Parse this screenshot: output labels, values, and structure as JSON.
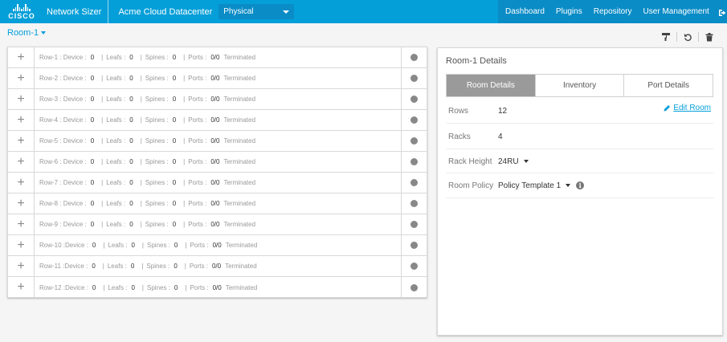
{
  "header": {
    "logo_text": "CISCO",
    "app_title": "Network Sizer",
    "datacenter": "Acme Cloud Datacenter",
    "view_select": "Physical",
    "nav": [
      "Dashboard",
      "Plugins",
      "Repository",
      "User Management"
    ],
    "accent_color": "#049fd9"
  },
  "room_selector": {
    "label": "Room-1"
  },
  "toolbar": {
    "icons": [
      "paint-roller-icon",
      "undo-icon",
      "trash-icon"
    ]
  },
  "labels": {
    "device": "Device :",
    "leafs": "Leafs :",
    "spines": "Spines :",
    "ports": "Ports :",
    "terminated": "Terminated",
    "sep": "|"
  },
  "rows": [
    {
      "name": "Row-1 :",
      "device": "0",
      "leafs": "0",
      "spines": "0",
      "ports": "0/0"
    },
    {
      "name": "Row-2 :",
      "device": "0",
      "leafs": "0",
      "spines": "0",
      "ports": "0/0"
    },
    {
      "name": "Row-3 :",
      "device": "0",
      "leafs": "0",
      "spines": "0",
      "ports": "0/0"
    },
    {
      "name": "Row-4 :",
      "device": "0",
      "leafs": "0",
      "spines": "0",
      "ports": "0/0"
    },
    {
      "name": "Row-5 :",
      "device": "0",
      "leafs": "0",
      "spines": "0",
      "ports": "0/0"
    },
    {
      "name": "Row-6 :",
      "device": "0",
      "leafs": "0",
      "spines": "0",
      "ports": "0/0"
    },
    {
      "name": "Row-7 :",
      "device": "0",
      "leafs": "0",
      "spines": "0",
      "ports": "0/0"
    },
    {
      "name": "Row-8 :",
      "device": "0",
      "leafs": "0",
      "spines": "0",
      "ports": "0/0"
    },
    {
      "name": "Row-9 :",
      "device": "0",
      "leafs": "0",
      "spines": "0",
      "ports": "0/0"
    },
    {
      "name": "Row-10 :",
      "device": "0",
      "leafs": "0",
      "spines": "0",
      "ports": "0/0"
    },
    {
      "name": "Row-11 :",
      "device": "0",
      "leafs": "0",
      "spines": "0",
      "ports": "0/0"
    },
    {
      "name": "Row-12 :",
      "device": "0",
      "leafs": "0",
      "spines": "0",
      "ports": "0/0"
    }
  ],
  "details": {
    "title": "Room-1 Details",
    "tabs": [
      "Room Details",
      "Inventory",
      "Port Details"
    ],
    "edit_room": "Edit Room",
    "fields": {
      "rows_label": "Rows",
      "rows_value": "12",
      "racks_label": "Racks",
      "racks_value": "4",
      "rack_height_label": "Rack Height",
      "rack_height_value": "24RU",
      "room_policy_label": "Room Policy",
      "room_policy_value": "Policy Template 1"
    }
  }
}
